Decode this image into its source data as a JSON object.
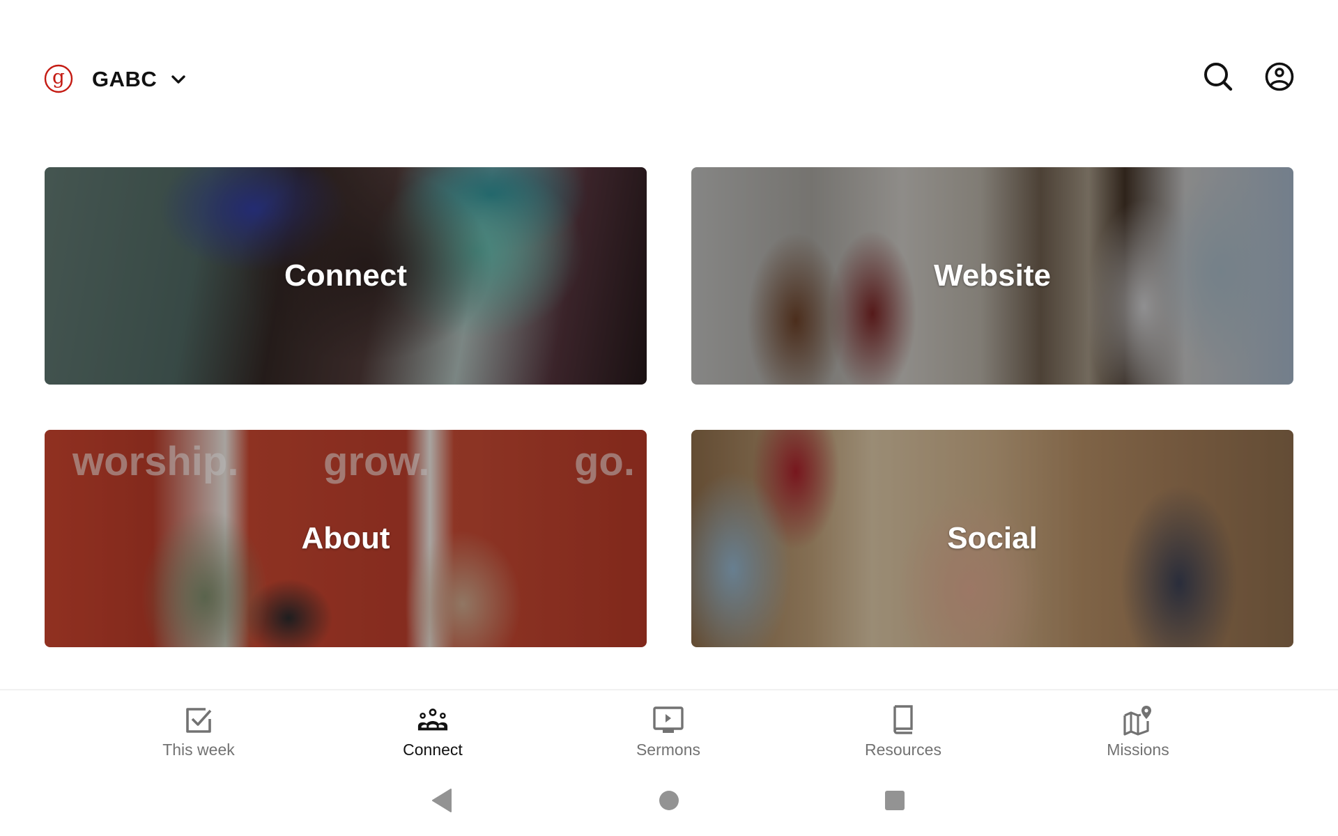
{
  "header": {
    "org_name": "GABC",
    "logo_icon": "gabc-logo-icon",
    "org_switch_icon": "chevron-down-icon",
    "search_icon": "search-icon",
    "account_icon": "account-circle-icon",
    "brand_color": "#c41a12"
  },
  "cards": [
    {
      "label": "Connect",
      "image": "people-hugging-photo"
    },
    {
      "label": "Website",
      "image": "church-lobby-photo"
    },
    {
      "label": "About",
      "image": "core-values-wall-photo",
      "watermarks": [
        "worship.",
        "grow.",
        "go."
      ]
    },
    {
      "label": "Social",
      "image": "women-talking-photo"
    }
  ],
  "bottom_nav": {
    "active": "Connect",
    "items": [
      {
        "label": "This week",
        "icon": "checkbox-icon"
      },
      {
        "label": "Connect",
        "icon": "groups-icon"
      },
      {
        "label": "Sermons",
        "icon": "video-play-icon"
      },
      {
        "label": "Resources",
        "icon": "book-icon"
      },
      {
        "label": "Missions",
        "icon": "map-pin-icon"
      }
    ]
  },
  "system_nav": {
    "back": "back-icon",
    "home": "home-icon",
    "recents": "recents-icon"
  }
}
